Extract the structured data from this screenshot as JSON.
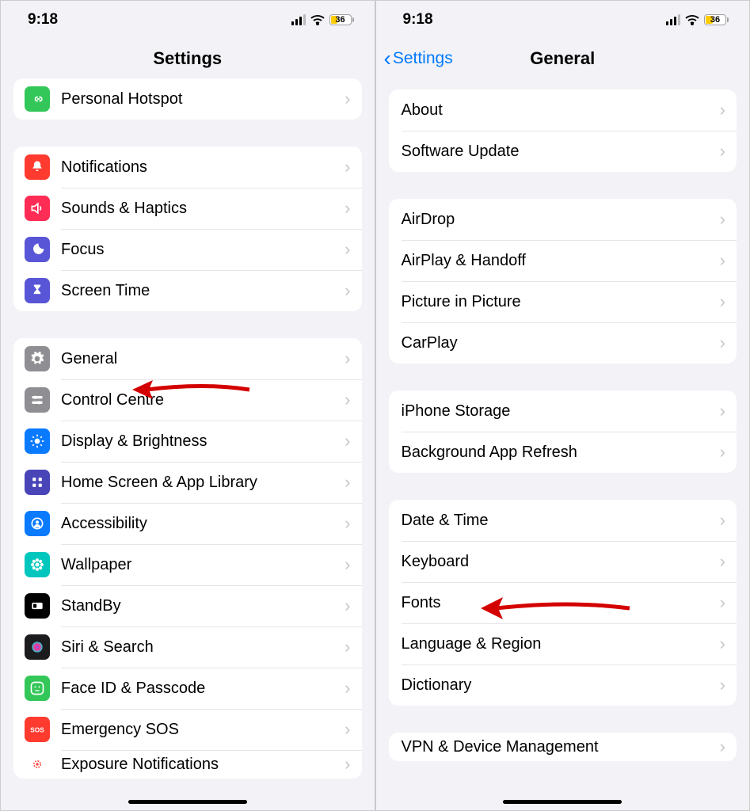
{
  "status": {
    "time": "9:18",
    "battery_percent": "36",
    "battery_color": "#ffcc00",
    "battery_fill_pct": 36
  },
  "left": {
    "title": "Settings",
    "groups": [
      {
        "rows": [
          {
            "key": "hotspot",
            "label": "Personal Hotspot",
            "icon": "link",
            "bg": "#33c759"
          }
        ]
      },
      {
        "rows": [
          {
            "key": "notifications",
            "label": "Notifications",
            "icon": "bell",
            "bg": "#ff3b30"
          },
          {
            "key": "sounds",
            "label": "Sounds & Haptics",
            "icon": "speaker",
            "bg": "#ff2d55"
          },
          {
            "key": "focus",
            "label": "Focus",
            "icon": "moon",
            "bg": "#5856d6"
          },
          {
            "key": "screentime",
            "label": "Screen Time",
            "icon": "hourglass",
            "bg": "#5856d6"
          }
        ]
      },
      {
        "rows": [
          {
            "key": "general",
            "label": "General",
            "icon": "gear",
            "bg": "#8e8e93"
          },
          {
            "key": "control",
            "label": "Control Centre",
            "icon": "sliders",
            "bg": "#8e8e93"
          },
          {
            "key": "display",
            "label": "Display & Brightness",
            "icon": "sun",
            "bg": "#0a7aff"
          },
          {
            "key": "home",
            "label": "Home Screen & App Library",
            "icon": "grid",
            "bg": "#4945b8"
          },
          {
            "key": "access",
            "label": "Accessibility",
            "icon": "person",
            "bg": "#0a7aff"
          },
          {
            "key": "wallpaper",
            "label": "Wallpaper",
            "icon": "flower",
            "bg": "#00c7be"
          },
          {
            "key": "standby",
            "label": "StandBy",
            "icon": "standby",
            "bg": "#000000"
          },
          {
            "key": "siri",
            "label": "Siri & Search",
            "icon": "siri",
            "bg": "#1c1c1e"
          },
          {
            "key": "faceid",
            "label": "Face ID & Passcode",
            "icon": "face",
            "bg": "#33c759"
          },
          {
            "key": "sos",
            "label": "Emergency SOS",
            "icon": "sos",
            "bg": "#ff3b30"
          },
          {
            "key": "exposure",
            "label": "Exposure Notifications",
            "icon": "exposure",
            "bg": "#ffffff",
            "cut": true
          }
        ]
      }
    ]
  },
  "right": {
    "title": "General",
    "back": "Settings",
    "groups": [
      {
        "rows": [
          {
            "key": "about",
            "label": "About"
          },
          {
            "key": "update",
            "label": "Software Update"
          }
        ]
      },
      {
        "rows": [
          {
            "key": "airdrop",
            "label": "AirDrop"
          },
          {
            "key": "airplay",
            "label": "AirPlay & Handoff"
          },
          {
            "key": "pip",
            "label": "Picture in Picture"
          },
          {
            "key": "carplay",
            "label": "CarPlay"
          }
        ]
      },
      {
        "rows": [
          {
            "key": "storage",
            "label": "iPhone Storage"
          },
          {
            "key": "refresh",
            "label": "Background App Refresh"
          }
        ]
      },
      {
        "rows": [
          {
            "key": "date",
            "label": "Date & Time"
          },
          {
            "key": "keyboard",
            "label": "Keyboard"
          },
          {
            "key": "fonts",
            "label": "Fonts"
          },
          {
            "key": "lang",
            "label": "Language & Region"
          },
          {
            "key": "dict",
            "label": "Dictionary"
          }
        ]
      },
      {
        "rows": [
          {
            "key": "vpn",
            "label": "VPN & Device Management",
            "cut": true
          }
        ]
      }
    ]
  }
}
